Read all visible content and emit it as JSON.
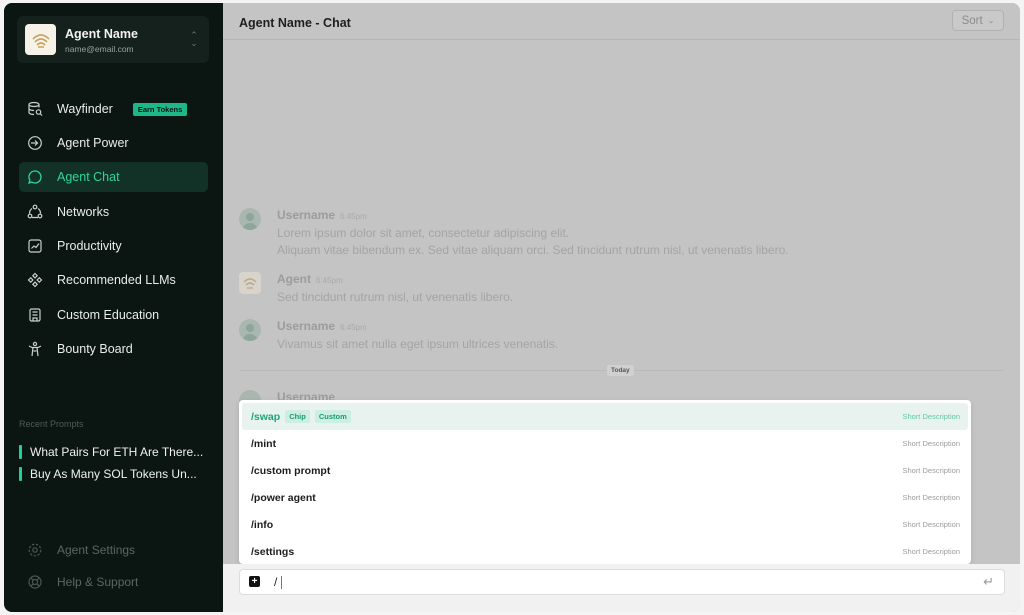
{
  "account": {
    "name": "Agent Name",
    "email": "name@email.com"
  },
  "nav": [
    {
      "label": "Wayfinder",
      "badge": "Earn Tokens",
      "icon": "database-search-icon"
    },
    {
      "label": "Agent Power",
      "icon": "login-arrow-icon"
    },
    {
      "label": "Agent Chat",
      "icon": "chat-bubble-icon",
      "active": true
    },
    {
      "label": "Networks",
      "icon": "network-nodes-icon"
    },
    {
      "label": "Productivity",
      "icon": "chart-line-icon"
    },
    {
      "label": "Recommended LLMs",
      "icon": "diamond-grid-icon"
    },
    {
      "label": "Custom Education",
      "icon": "document-book-icon"
    },
    {
      "label": "Bounty Board",
      "icon": "person-pose-icon"
    }
  ],
  "recent": {
    "title": "Recent Prompts",
    "items": [
      "What Pairs For ETH Are There...",
      "Buy As Many SOL Tokens Un..."
    ]
  },
  "footer": [
    {
      "label": "Agent Settings",
      "icon": "gear-icon"
    },
    {
      "label": "Help & Support",
      "icon": "lifebuoy-icon"
    }
  ],
  "header": {
    "title": "Agent Name - Chat",
    "sort_label": "Sort"
  },
  "messages": [
    {
      "author": "Username",
      "time": "6:45pm",
      "lines": [
        "Lorem ipsum dolor sit amet, consectetur adipiscing elit.",
        "Aliquam vitae bibendum ex. Sed vitae aliquam orci. Sed tincidunt rutrum nisl, ut venenatis libero."
      ]
    },
    {
      "author": "Agent",
      "time": "6:45pm",
      "lines": [
        "Sed tincidunt rutrum nisl, ut venenatis libero."
      ]
    },
    {
      "author": "Username",
      "time": "6:45pm",
      "lines": [
        "Vivamus sit amet nulla eget ipsum ultrices venenatis."
      ]
    }
  ],
  "divider_label": "Today",
  "ghost_author": "Username",
  "commands": [
    {
      "name": "/swap",
      "chips": [
        "Chip",
        "Custom"
      ],
      "desc": "Short Description",
      "active": true
    },
    {
      "name": "/mint",
      "desc": "Short Description"
    },
    {
      "name": "/custom prompt",
      "desc": "Short Description"
    },
    {
      "name": "/power agent",
      "desc": "Short Description"
    },
    {
      "name": "/info",
      "desc": "Short Description"
    },
    {
      "name": "/settings",
      "desc": "Short Description"
    }
  ],
  "input": {
    "value": "/"
  },
  "colors": {
    "sidebar_bg": "#0b1612",
    "accent": "#1fd19a",
    "active_text": "#2fd3a0"
  }
}
